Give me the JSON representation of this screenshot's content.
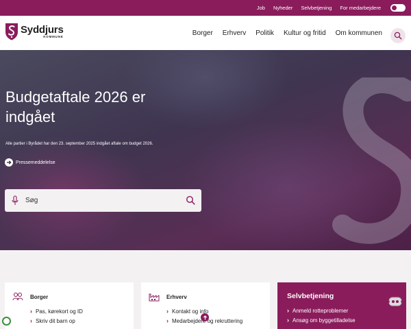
{
  "util_nav": {
    "links": [
      "Job",
      "Nyheder",
      "Selvbetjening",
      "For medarbejdere"
    ]
  },
  "header": {
    "logo_name": "Syddjurs",
    "logo_sub": "KOMMUNE",
    "nav": [
      "Borger",
      "Erhverv",
      "Politik",
      "Kultur og fritid",
      "Om kommunen"
    ]
  },
  "hero": {
    "title": "Budgetaftale 2026 er indgået",
    "description": "Alle partier i Byrådet har den 23. september 2025 indgået aftale om budget 2026.",
    "link": "Pressemeddelelse",
    "search_placeholder": "Søg"
  },
  "cards": [
    {
      "title": "Borger",
      "items": [
        "Pas, kørekort og ID",
        "Skriv dit barn op"
      ]
    },
    {
      "title": "Erhverv",
      "items": [
        "Kontakt og info",
        "Medarbejdere og rekruttering"
      ]
    },
    {
      "title": "Selvbetjening",
      "items": [
        "Anmeld rotteproblemer",
        "Ansøg om byggetilladelse"
      ]
    }
  ],
  "colors": {
    "brand": "#8a1c5c",
    "card_bg": "#ffffff",
    "page_bg": "#f4f1f3"
  }
}
